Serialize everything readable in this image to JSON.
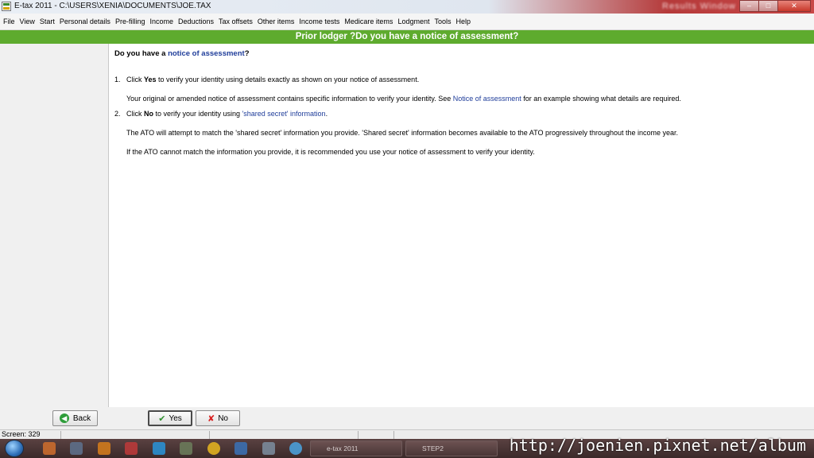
{
  "window": {
    "title": "E-tax 2011 - C:\\USERS\\XENIA\\DOCUMENTS\\JOE.TAX",
    "blurred_text": "Results Window"
  },
  "menu": [
    "File",
    "View",
    "Start",
    "Personal details",
    "Pre-filling",
    "Income",
    "Deductions",
    "Tax offsets",
    "Other items",
    "Income tests",
    "Medicare items",
    "Lodgment",
    "Tools",
    "Help"
  ],
  "header": {
    "title": "Prior lodger ?Do you have a notice of assessment?"
  },
  "content": {
    "question_prefix": "Do you have a ",
    "question_link": "notice of assessment",
    "question_suffix": "?",
    "item1_num": "1.",
    "item1_pre": "Click ",
    "item1_bold": "Yes",
    "item1_post": " to verify your identity using details exactly as shown on your notice of assessment.",
    "item1_sub_pre": "Your original or amended notice of assessment contains specific information to verify your identity. See ",
    "item1_sub_link": "Notice of assessment",
    "item1_sub_post": " for an example showing what details are required.",
    "item2_num": "2.",
    "item2_pre": "Click ",
    "item2_bold": "No",
    "item2_mid": " to verify your identity using ",
    "item2_link": "'shared secret' information",
    "item2_post": ".",
    "item2_sub1": "The ATO will attempt to match the 'shared secret' information you provide. 'Shared secret' information becomes available to the ATO progressively throughout the income year.",
    "item2_sub2": "If the ATO cannot match the information you provide, it is recommended you use your notice of assessment to verify your identity."
  },
  "buttons": {
    "back": "Back",
    "yes": "Yes",
    "no": "No"
  },
  "status": {
    "screen": "Screen: 329"
  },
  "taskbar": {
    "task1": "e-tax 2011",
    "task2": "STEP2"
  },
  "watermark": "http://joenien.pixnet.net/album",
  "colors": {
    "header_green": "#5eab2e",
    "link_blue": "#1f3d9a",
    "titlebar_red": "#c94848"
  }
}
